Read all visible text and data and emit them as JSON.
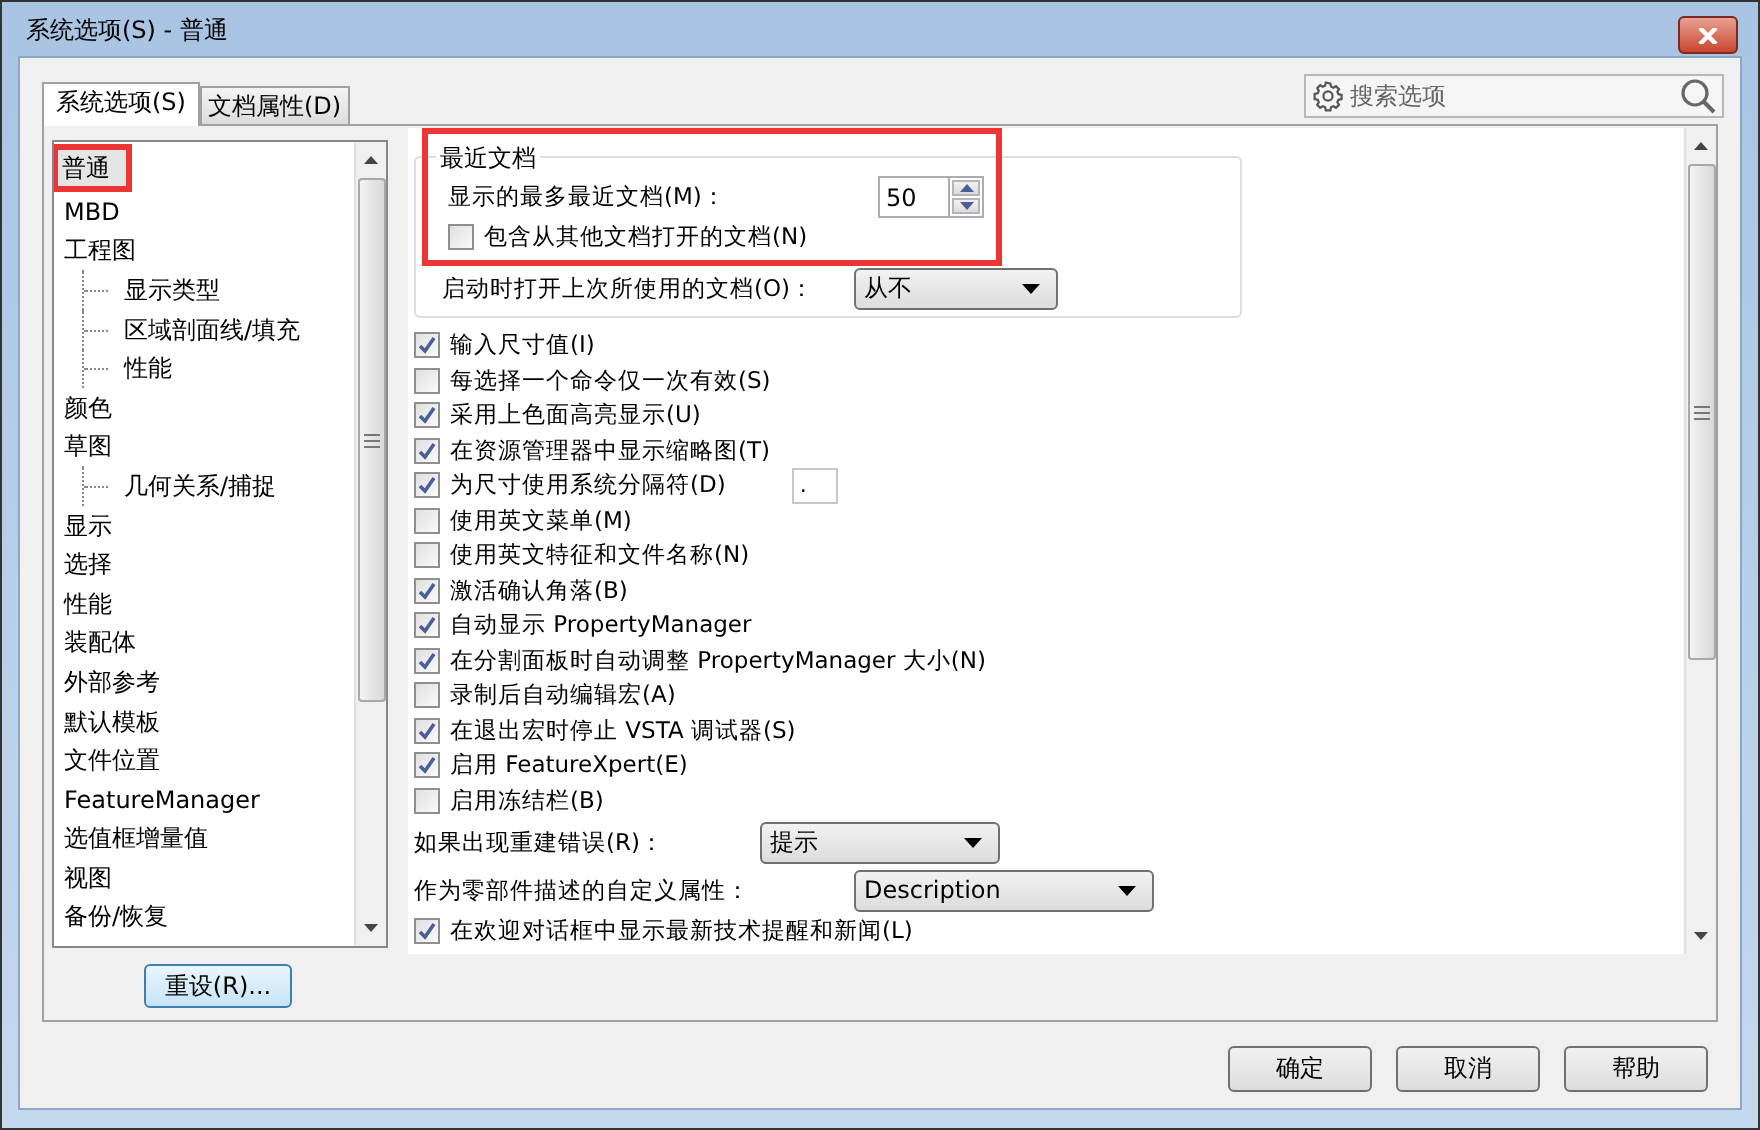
{
  "window": {
    "title": "系统选项(S) - 普通"
  },
  "tabs": [
    {
      "label": "系统选项(S)",
      "selected": true
    },
    {
      "label": "文档属性(D)",
      "selected": false
    }
  ],
  "search": {
    "placeholder": "搜索选项"
  },
  "tree": [
    {
      "label": "普通",
      "selected": true,
      "annotated": true
    },
    {
      "label": "MBD",
      "selected": false
    },
    {
      "label": "工程图",
      "selected": false,
      "children": [
        {
          "label": "显示类型",
          "selected": false
        },
        {
          "label": "区域剖面线/填充",
          "selected": false
        },
        {
          "label": "性能",
          "selected": false
        }
      ]
    },
    {
      "label": "颜色",
      "selected": false
    },
    {
      "label": "草图",
      "selected": false,
      "children": [
        {
          "label": "几何关系/捕捉",
          "selected": false
        }
      ]
    },
    {
      "label": "显示",
      "selected": false
    },
    {
      "label": "选择",
      "selected": false
    },
    {
      "label": "性能",
      "selected": false
    },
    {
      "label": "装配体",
      "selected": false
    },
    {
      "label": "外部参考",
      "selected": false
    },
    {
      "label": "默认模板",
      "selected": false
    },
    {
      "label": "文件位置",
      "selected": false
    },
    {
      "label": "FeatureManager",
      "selected": false
    },
    {
      "label": "选值框增量值",
      "selected": false
    },
    {
      "label": "视图",
      "selected": false
    },
    {
      "label": "备份/恢复",
      "selected": false
    }
  ],
  "reset_button": "重设(R)...",
  "recent_documents": {
    "title": "最近文档",
    "annotated": true,
    "max_label": "显示的最多最近文档(M)：",
    "max_value": "50",
    "include_others": {
      "label": "包含从其他文档打开的文档(N)",
      "checked": false
    },
    "open_on_startup": {
      "label": "启动时打开上次所使用的文档(O)：",
      "value": "从不"
    }
  },
  "options": [
    {
      "kind": "checkbox",
      "label": "输入尺寸值(I)",
      "checked": true
    },
    {
      "kind": "checkbox",
      "label": "每选择一个命令仅一次有效(S)",
      "checked": false
    },
    {
      "kind": "checkbox",
      "label": "采用上色面高亮显示(U)",
      "checked": true
    },
    {
      "kind": "checkbox",
      "label": "在资源管理器中显示缩略图(T)",
      "checked": true
    },
    {
      "kind": "checkbox",
      "label": "为尺寸使用系统分隔符(D)",
      "checked": true,
      "field_value": "."
    },
    {
      "kind": "checkbox",
      "label": "使用英文菜单(M)",
      "checked": false
    },
    {
      "kind": "checkbox",
      "label": "使用英文特征和文件名称(N)",
      "checked": false
    },
    {
      "kind": "checkbox",
      "label": "激活确认角落(B)",
      "checked": true
    },
    {
      "kind": "checkbox",
      "label": "自动显示 PropertyManager",
      "checked": true
    },
    {
      "kind": "checkbox",
      "label": "在分割面板时自动调整 PropertyManager 大小(N)",
      "checked": true
    },
    {
      "kind": "checkbox",
      "label": "录制后自动编辑宏(A)",
      "checked": false
    },
    {
      "kind": "checkbox",
      "label": "在退出宏时停止 VSTA 调试器(S)",
      "checked": true
    },
    {
      "kind": "checkbox",
      "label": "启用 FeatureXpert(E)",
      "checked": true
    },
    {
      "kind": "checkbox",
      "label": "启用冻结栏(B)",
      "checked": false
    },
    {
      "kind": "dropdown",
      "label": "如果出现重建错误(R)：",
      "value": "提示"
    },
    {
      "kind": "dropdown",
      "label": "作为零部件描述的自定义属性：",
      "value": "Description"
    },
    {
      "kind": "checkbox",
      "label": "在欢迎对话框中显示最新技术提醒和新闻(L)",
      "checked": true
    }
  ],
  "buttons": [
    "确定",
    "取消",
    "帮助"
  ]
}
